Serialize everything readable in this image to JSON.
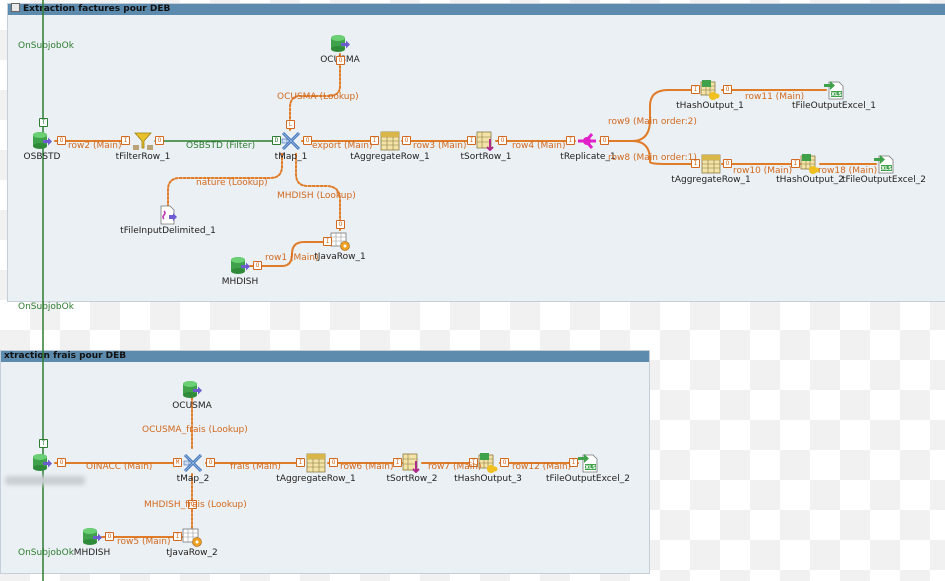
{
  "colors": {
    "main_flow": "#e07b28",
    "lookup_flow": "#e07b28",
    "filter_flow": "#2e7d32",
    "trigger": "#2e7d32",
    "subjob_title": "#5c8bad"
  },
  "subjobs": [
    {
      "title": "Extraction factures pour DEB"
    },
    {
      "title": "xtraction frais pour DEB"
    }
  ],
  "triggers": [
    "OnSubjobOk",
    "OnSubjobOk",
    "OnSubjobOk"
  ],
  "components": {
    "c1": {
      "label": "OSBSTD",
      "icon": "database-input-icon"
    },
    "c2": {
      "label": "tFilterRow_1",
      "icon": "filter-icon"
    },
    "c3": {
      "label": "tMap_1",
      "icon": "map-icon"
    },
    "c4": {
      "label": "OCUSMA",
      "icon": "database-input-icon"
    },
    "c5": {
      "label": "tFileInputDelimited_1",
      "icon": "file-input-icon"
    },
    "c6": {
      "label": "MHDISH",
      "icon": "database-input-icon"
    },
    "c7": {
      "label": "tJavaRow_1",
      "icon": "java-row-icon"
    },
    "c8": {
      "label": "tAggregateRow_1",
      "icon": "aggregate-icon"
    },
    "c9": {
      "label": "tSortRow_1",
      "icon": "sort-icon"
    },
    "c10": {
      "label": "tReplicate_1",
      "icon": "replicate-icon"
    },
    "c11": {
      "label": "tHashOutput_1",
      "icon": "hash-output-icon"
    },
    "c12": {
      "label": "tFileOutputExcel_1",
      "icon": "excel-output-icon"
    },
    "c13": {
      "label": "tAggregateRow_1",
      "icon": "aggregate-icon"
    },
    "c14": {
      "label": "tHashOutput_2",
      "icon": "hash-output-icon"
    },
    "c15": {
      "label": "tFileOutputExcel_2",
      "icon": "excel-output-icon"
    },
    "d0": {
      "label": "",
      "icon": "database-input-icon"
    },
    "d1": {
      "label": "OCUSMA",
      "icon": "database-input-icon"
    },
    "d2": {
      "label": "tMap_2",
      "icon": "map-icon"
    },
    "d3": {
      "label": "tAggregateRow_1",
      "icon": "aggregate-icon"
    },
    "d4": {
      "label": "tSortRow_2",
      "icon": "sort-icon"
    },
    "d5": {
      "label": "tHashOutput_3",
      "icon": "hash-output-icon"
    },
    "d6": {
      "label": "tFileOutputExcel_2",
      "icon": "excel-output-icon"
    },
    "d7": {
      "label": "MHDISH",
      "icon": "database-input-icon"
    },
    "d8": {
      "label": "tJavaRow_2",
      "icon": "java-row-icon"
    }
  },
  "links": {
    "l1": "row2 (Main)",
    "l2": "OSBSTD (Filter)",
    "l3": "OCUSMA (Lookup)",
    "l4": "nature (Lookup)",
    "l5": "MHDISH (Lookup)",
    "l6": "row1 (Main)",
    "l7": "export (Main)",
    "l8": "row3 (Main)",
    "l9": "row4 (Main)",
    "l10": "row9 (Main order:2)",
    "l11": "row8 (Main order:1)",
    "l12": "row11 (Main)",
    "l13": "row10 (Main)",
    "l14": "row18 (Main)",
    "m1": "OINACC (Main)",
    "m2": "OCUSMA_frais (Lookup)",
    "m3": "frais (Main)",
    "m4": "row6 (Main)",
    "m5": "row7 (Main)",
    "m6": "row12 (Main)",
    "m7": "MHDISH_frais (Lookup)",
    "m8": "row5 (Main)"
  }
}
